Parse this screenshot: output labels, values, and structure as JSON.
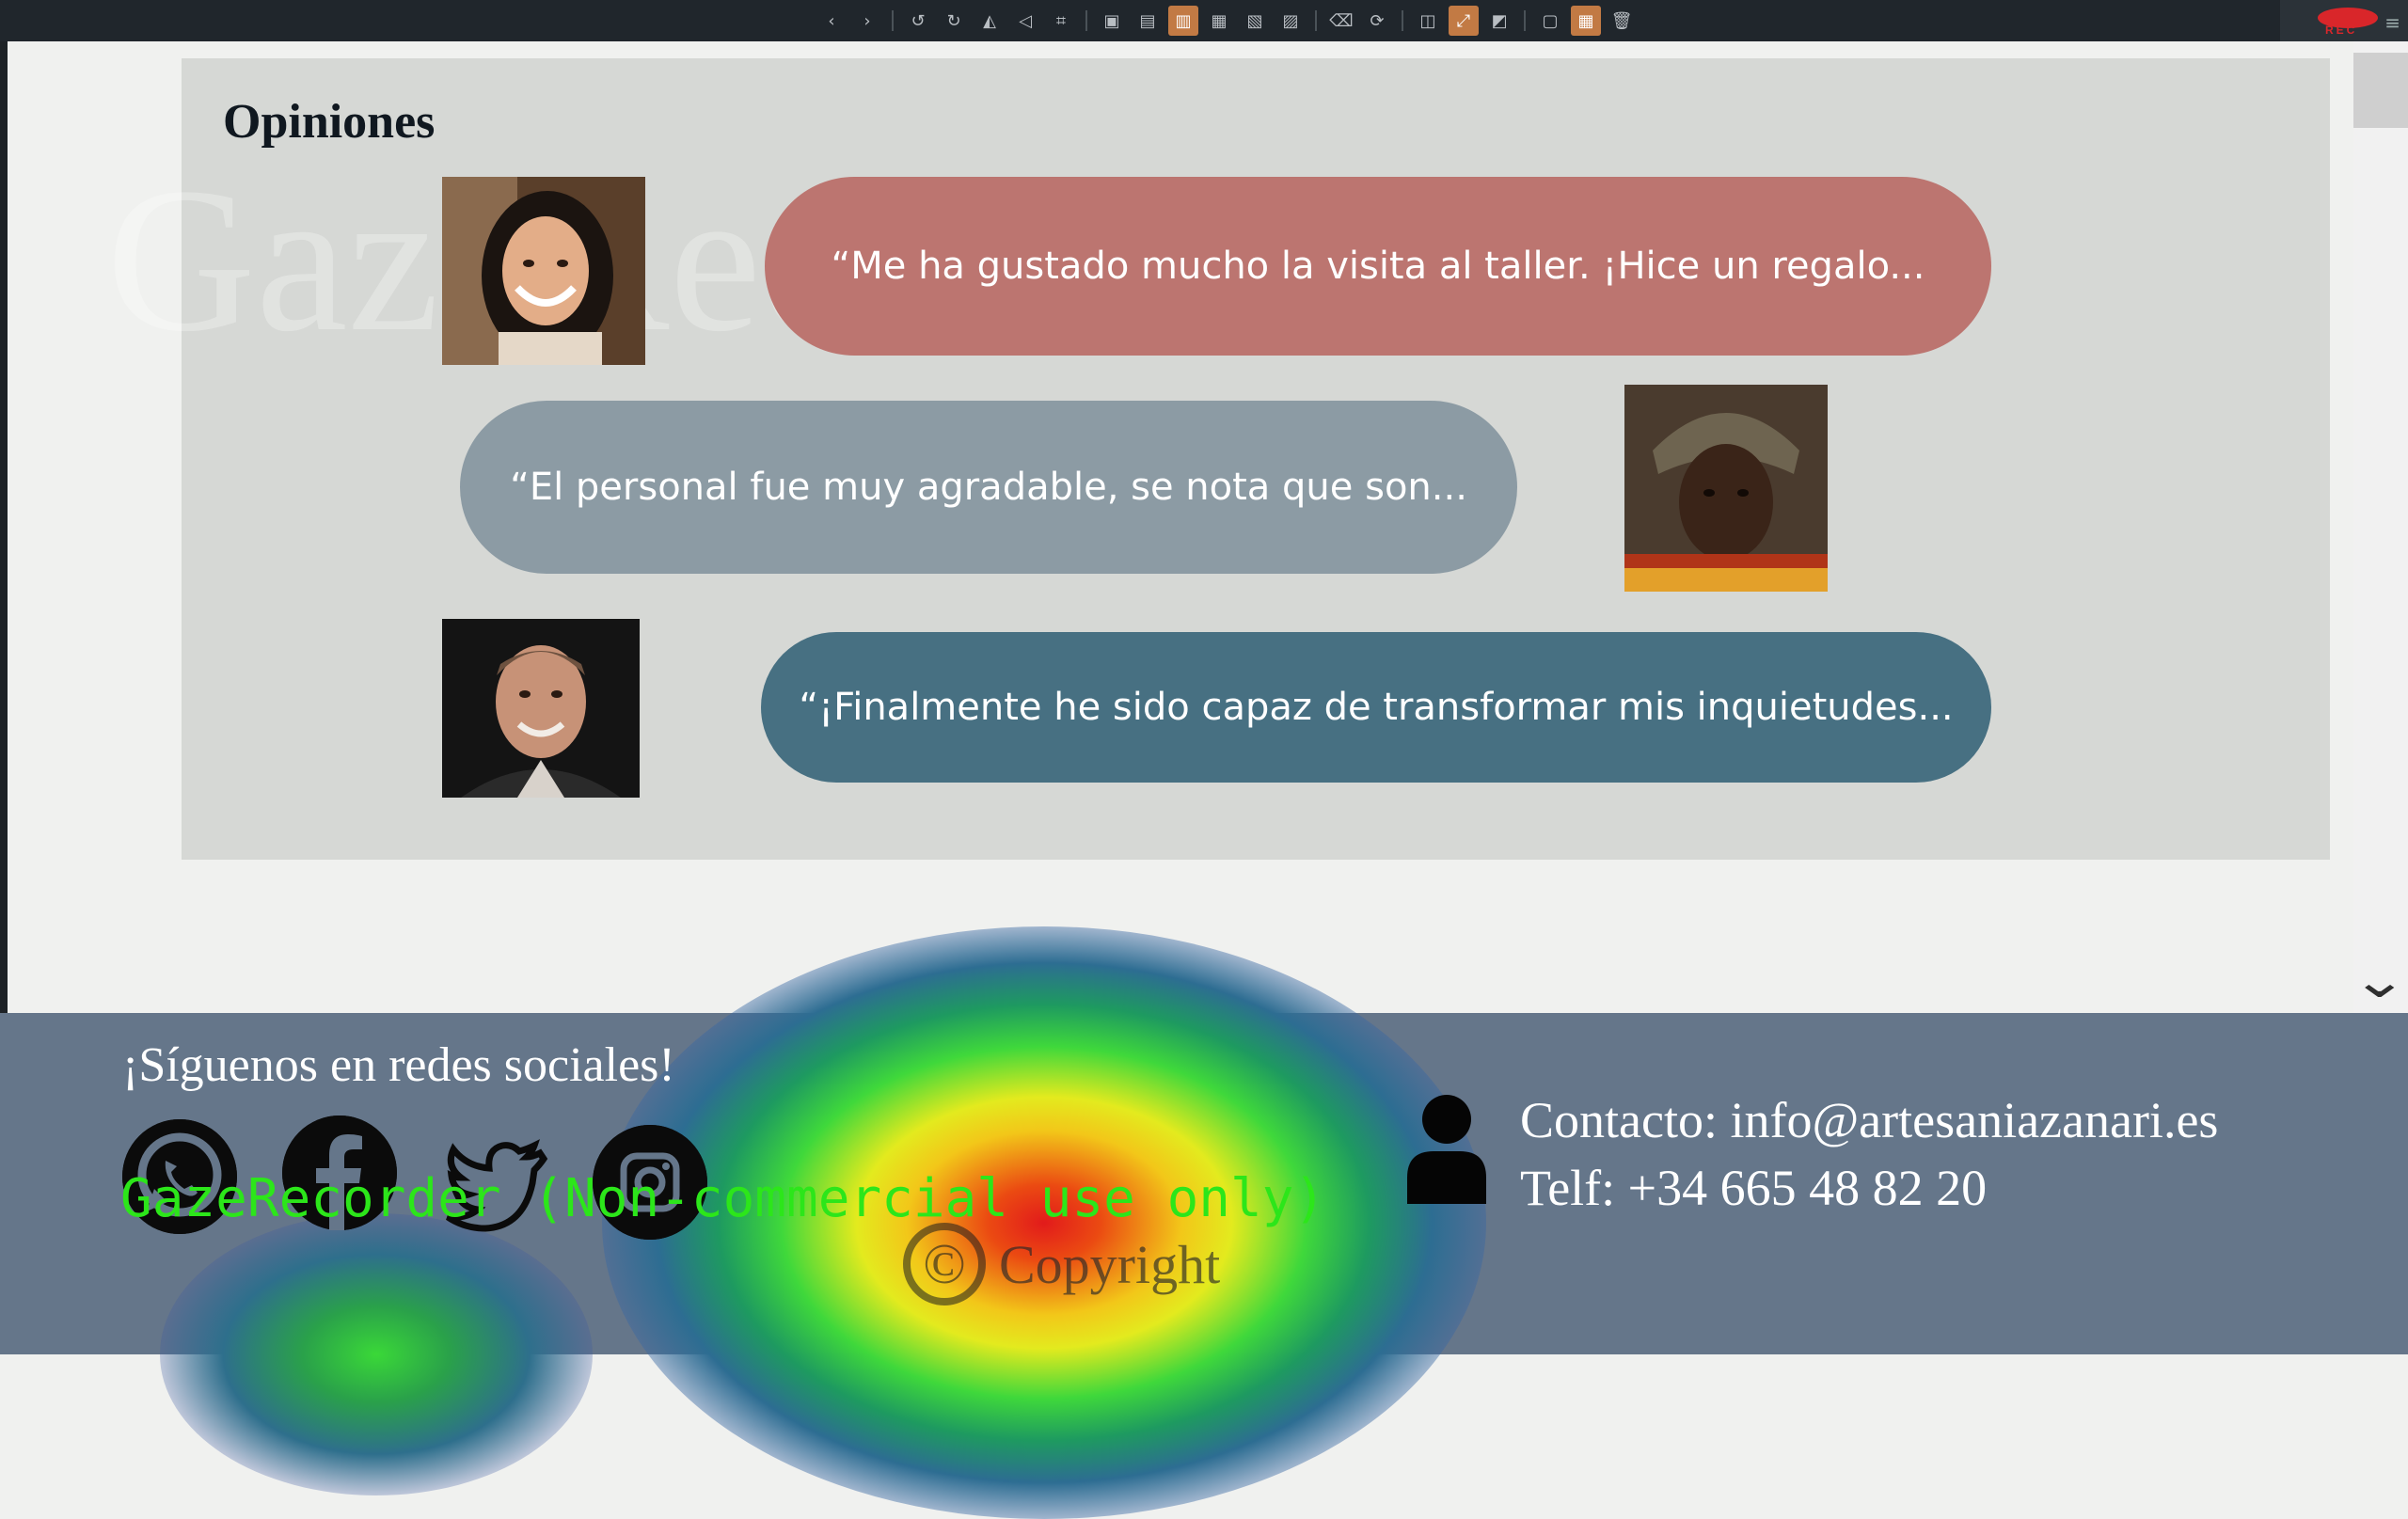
{
  "toolbar": {
    "icons": [
      "back-icon",
      "forward-icon",
      "undo-icon",
      "redo-icon",
      "flip-icon",
      "rotate-icon",
      "crop-icon",
      "frame-icon",
      "frame-lock-icon",
      "frame-active-icon",
      "frame-b-icon",
      "frame-c-icon",
      "frame-d-icon",
      "eraser-icon",
      "refresh-icon",
      "layout-icon",
      "resize-icon",
      "chat-icon",
      "image-icon",
      "grid-icon",
      "trash-icon"
    ],
    "rec_label": "REC"
  },
  "reviews": {
    "title": "Opiniones",
    "watermark": "GazeRecorder",
    "items": [
      {
        "quote": "“Me ha gustado mucho la visita al taller. ¡Hice un regalo...",
        "color": "#bc7570"
      },
      {
        "quote": "“El personal fue muy agradable, se nota que son...",
        "color": "#8c9ba4"
      },
      {
        "quote": "“¡Finalmente he sido capaz de transformar mis inquietudes...",
        "color": "#477082"
      }
    ]
  },
  "footer": {
    "follow_title": "¡Síguenos en redes sociales!",
    "social": [
      "whatsapp-icon",
      "facebook-icon",
      "twitter-icon",
      "instagram-icon"
    ],
    "contact_email": "Contacto: info@artesaniazanari.es",
    "contact_phone": "Telf: +34 665 48 82 20",
    "copyright": "Copyright",
    "copyright_symbol": "©"
  },
  "overlay": {
    "gaze_text": "GazeRecorder (Non-commercial use only)"
  },
  "colors": {
    "footer_bg": "#65768a",
    "card_bg": "#d6d8d5",
    "accent": "#c27a44"
  }
}
